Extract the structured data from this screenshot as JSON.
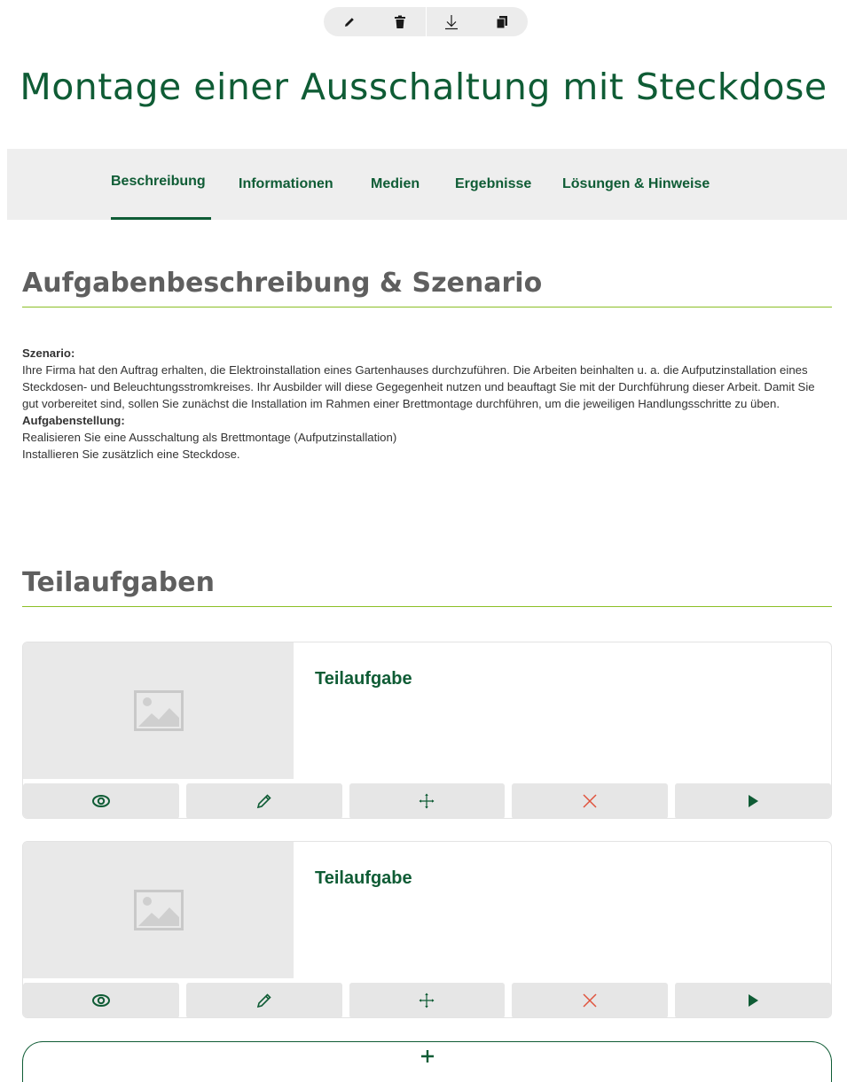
{
  "toolbar": {
    "items": [
      "pencil-icon",
      "trash-icon",
      "download-icon",
      "copy-icon"
    ]
  },
  "page": {
    "title": "Montage einer Ausschaltung mit Steckdose"
  },
  "tabs": [
    {
      "label": "Beschreibung",
      "active": true
    },
    {
      "label": "Informationen",
      "active": false
    },
    {
      "label": "Medien",
      "active": false
    },
    {
      "label": "Ergebnisse",
      "active": false
    },
    {
      "label": "Lösungen & Hinweise",
      "active": false
    }
  ],
  "description": {
    "heading": "Aufgabenbeschreibung & Szenario",
    "scenario_label": "Szenario:",
    "scenario_text": "Ihre Firma hat den Auftrag erhalten, die Elektroinstallation eines Gartenhauses durchzuführen. Die Arbeiten beinhalten u. a. die Aufputzinstallation eines Steckdosen- und Beleuchtungsstromkreises. Ihr Ausbilder will diese Gegegenheit nutzen und beauftagt Sie mit der Durchführung dieser Arbeit. Damit Sie gut vorbereitet sind, sollen Sie zunächst die Installation im Rahmen einer Brettmontage durchführen, um die jeweiligen Handlungsschritte zu üben.",
    "task_label": "Aufgabenstellung:",
    "task_lines": [
      "Realisieren Sie eine Ausschaltung als Brettmontage (Aufputzinstallation)",
      "Installieren Sie zusätzlich eine Steckdose."
    ]
  },
  "subtasks": {
    "heading": "Teilaufgaben",
    "items": [
      {
        "title": "Teilaufgabe"
      },
      {
        "title": "Teilaufgabe"
      }
    ],
    "actions": [
      "view-icon",
      "pencil-icon",
      "move-icon",
      "delete-icon",
      "play-icon"
    ],
    "add_label": "+"
  },
  "colors": {
    "brand_green": "#0f5c35",
    "accent_line": "#8cbf26",
    "delete_red": "#e0533d"
  }
}
